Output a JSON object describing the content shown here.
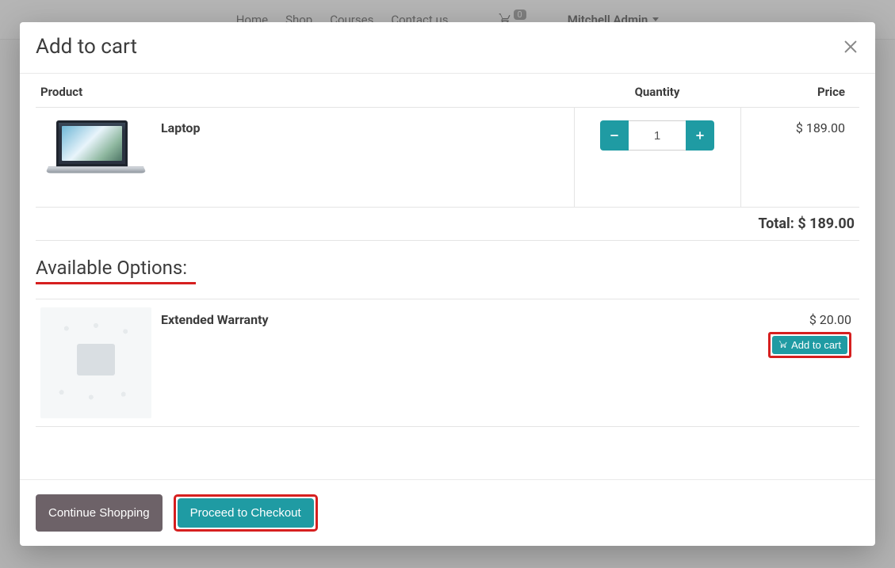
{
  "nav": {
    "items": [
      "Home",
      "Shop",
      "Courses",
      "Contact us"
    ],
    "cart_count": "0",
    "user_name": "Mitchell Admin"
  },
  "modal": {
    "title": "Add to cart",
    "headers": {
      "product": "Product",
      "quantity": "Quantity",
      "price": "Price"
    },
    "cart_items": [
      {
        "name": "Laptop",
        "quantity": "1",
        "price": "$ 189.00"
      }
    ],
    "total_label": "Total:",
    "total_value": "$ 189.00",
    "options_heading": "Available Options:",
    "options": [
      {
        "name": "Extended Warranty",
        "price": "$ 20.00",
        "add_label": "Add to cart"
      }
    ],
    "footer": {
      "continue": "Continue Shopping",
      "checkout": "Proceed to Checkout"
    }
  }
}
